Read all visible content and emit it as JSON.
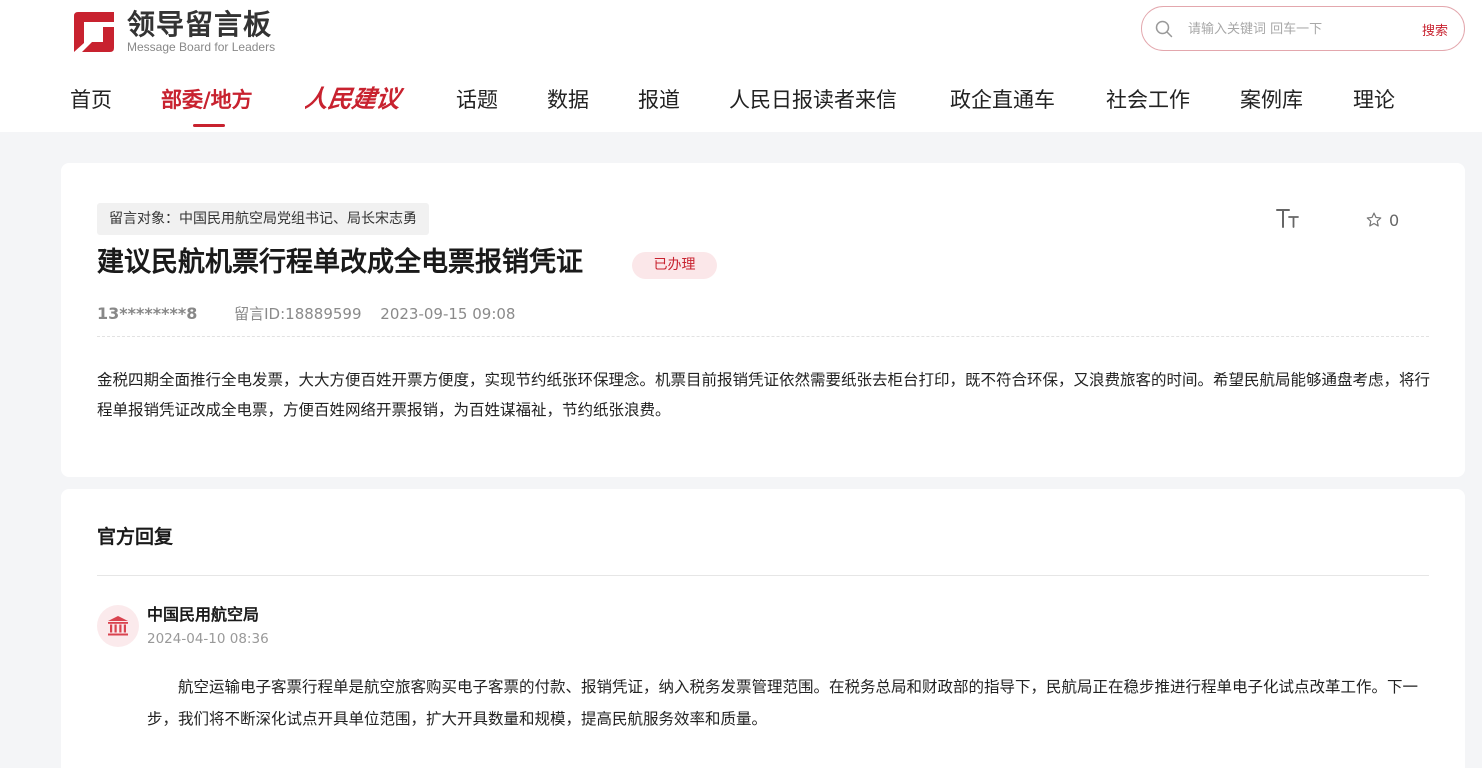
{
  "brand": {
    "name_cn": "领导留言板",
    "name_en": "Message Board for Leaders",
    "accent_color": "#c8222f"
  },
  "search": {
    "placeholder": "请输入关键词 回车一下",
    "value": "",
    "button_label": "搜索"
  },
  "nav": {
    "items": [
      {
        "label": "首页",
        "active": false
      },
      {
        "label": "部委/地方",
        "active": true
      },
      {
        "label": "人民建议",
        "active": false,
        "style": "calligraphy-logo"
      },
      {
        "label": "话题",
        "active": false
      },
      {
        "label": "数据",
        "active": false
      },
      {
        "label": "报道",
        "active": false
      },
      {
        "label": "人民日报读者来信",
        "active": false
      },
      {
        "label": "政企直通车",
        "active": false
      },
      {
        "label": "社会工作",
        "active": false
      },
      {
        "label": "案例库",
        "active": false
      },
      {
        "label": "理论",
        "active": false
      }
    ]
  },
  "message": {
    "target": "留言对象：中国民用航空局党组书记、局长宋志勇",
    "title": "建议民航机票行程单改成全电票报销凭证",
    "status": "已办理",
    "user": "13********8",
    "id_text": "留言ID:18889599",
    "time": "2023-09-15 09:08",
    "favorites_count": "0",
    "content": "金税四期全面推行全电发票，大大方便百姓开票方便度，实现节约纸张环保理念。机票目前报销凭证依然需要纸张去柜台打印，既不符合环保，又浪费旅客的时间。希望民航局能够通盘考虑，将行程单报销凭证改成全电票，方便百姓网络开票报销，为百姓谋福祉，节约纸张浪费。"
  },
  "reply": {
    "heading": "官方回复",
    "org": "中国民用航空局",
    "time": "2024-04-10 08:36",
    "content": "航空运输电子客票行程单是航空旅客购买电子客票的付款、报销凭证，纳入税务发票管理范围。在税务总局和财政部的指导下，民航局正在稳步推进行程单电子化试点改革工作。下一步，我们将不断深化试点开具单位范围，扩大开具数量和规模，提高民航服务效率和质量。"
  }
}
